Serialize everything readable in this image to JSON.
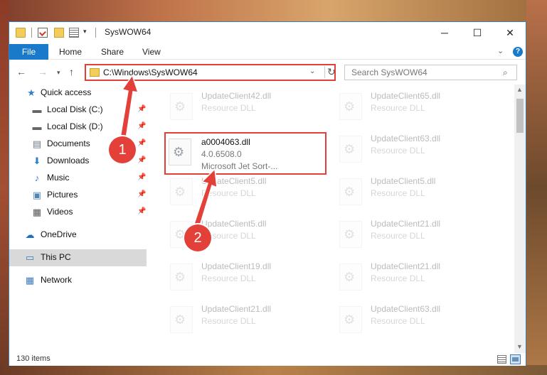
{
  "window": {
    "title": "SysWOW64",
    "controls": {
      "minimize": "─",
      "maximize": "☐",
      "close": "✕"
    }
  },
  "ribbon": {
    "file_tab": "File",
    "tabs": [
      "Home",
      "Share",
      "View"
    ],
    "help_label": "?"
  },
  "navigation": {
    "address_path": "C:\\Windows\\SysWOW64",
    "search_placeholder": "Search SysWOW64"
  },
  "sidebar": {
    "items": [
      {
        "label": "Quick access",
        "icon": "star-icon",
        "pinned": false
      },
      {
        "label": "Local Disk (C:)",
        "icon": "drive-icon",
        "pinned": true
      },
      {
        "label": "Local Disk (D:)",
        "icon": "drive-icon",
        "pinned": true
      },
      {
        "label": "Documents",
        "icon": "documents-icon",
        "pinned": true
      },
      {
        "label": "Downloads",
        "icon": "download-icon",
        "pinned": true
      },
      {
        "label": "Music",
        "icon": "music-icon",
        "pinned": true
      },
      {
        "label": "Pictures",
        "icon": "pictures-icon",
        "pinned": true
      },
      {
        "label": "Videos",
        "icon": "videos-icon",
        "pinned": true
      },
      {
        "label": "OneDrive",
        "icon": "cloud-icon",
        "pinned": false
      },
      {
        "label": "This PC",
        "icon": "computer-icon",
        "pinned": false,
        "selected": true
      },
      {
        "label": "Network",
        "icon": "network-icon",
        "pinned": false
      }
    ]
  },
  "files": {
    "highlighted": {
      "name": "a0004063.dll",
      "version": "4.0.6508.0",
      "description": "Microsoft Jet Sort-..."
    },
    "faded_left": [
      {
        "name": "UpdateClient42.dll",
        "type": "Resource DLL"
      },
      {
        "name": "UpdateClient5.dll",
        "type": "Resource DLL"
      },
      {
        "name": "UpdateClient5.dll",
        "type": "Resource DLL"
      },
      {
        "name": "UpdateClient19.dll",
        "type": "Resource DLL"
      },
      {
        "name": "UpdateClient21.dll",
        "type": "Resource DLL"
      }
    ],
    "faded_right": [
      {
        "name": "UpdateClient65.dll",
        "type": "Resource DLL"
      },
      {
        "name": "UpdateClient63.dll",
        "type": "Resource DLL"
      },
      {
        "name": "UpdateClient5.dll",
        "type": "Resource DLL"
      },
      {
        "name": "UpdateClient21.dll",
        "type": "Resource DLL"
      },
      {
        "name": "UpdateClient21.dll",
        "type": "Resource DLL"
      },
      {
        "name": "UpdateClient63.dll",
        "type": "Resource DLL"
      }
    ]
  },
  "status": {
    "item_count": "130 items"
  },
  "callouts": {
    "step1": "1",
    "step2": "2"
  },
  "colors": {
    "accent": "#1979ca",
    "highlight_red": "#e0403a"
  }
}
